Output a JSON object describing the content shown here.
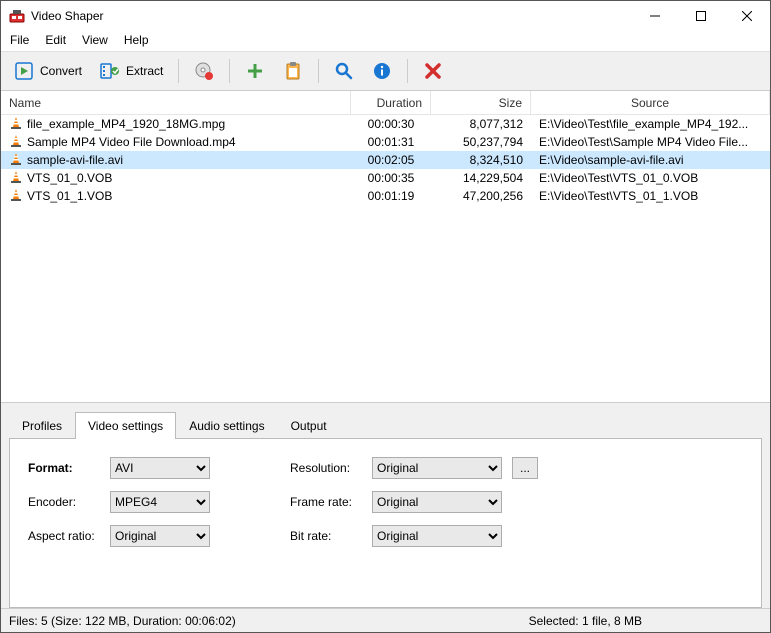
{
  "window": {
    "title": "Video Shaper"
  },
  "menubar": [
    "File",
    "Edit",
    "View",
    "Help"
  ],
  "toolbar": {
    "convert_label": "Convert",
    "extract_label": "Extract"
  },
  "columns": {
    "name": "Name",
    "duration": "Duration",
    "size": "Size",
    "source": "Source"
  },
  "files": [
    {
      "name": "file_example_MP4_1920_18MG.mpg",
      "duration": "00:00:30",
      "size": "8,077,312",
      "source": "E:\\Video\\Test\\file_example_MP4_192...",
      "selected": false
    },
    {
      "name": "Sample MP4 Video File Download.mp4",
      "duration": "00:01:31",
      "size": "50,237,794",
      "source": "E:\\Video\\Test\\Sample MP4 Video File...",
      "selected": false
    },
    {
      "name": "sample-avi-file.avi",
      "duration": "00:02:05",
      "size": "8,324,510",
      "source": "E:\\Video\\sample-avi-file.avi",
      "selected": true
    },
    {
      "name": "VTS_01_0.VOB",
      "duration": "00:00:35",
      "size": "14,229,504",
      "source": "E:\\Video\\Test\\VTS_01_0.VOB",
      "selected": false
    },
    {
      "name": "VTS_01_1.VOB",
      "duration": "00:01:19",
      "size": "47,200,256",
      "source": "E:\\Video\\Test\\VTS_01_1.VOB",
      "selected": false
    }
  ],
  "tabs": [
    "Profiles",
    "Video settings",
    "Audio settings",
    "Output"
  ],
  "active_tab": 1,
  "video_settings": {
    "labels": {
      "format": "Format:",
      "encoder": "Encoder:",
      "aspect": "Aspect ratio:",
      "resolution": "Resolution:",
      "framerate": "Frame rate:",
      "bitrate": "Bit rate:"
    },
    "values": {
      "format": "AVI",
      "encoder": "MPEG4",
      "aspect": "Original",
      "resolution": "Original",
      "framerate": "Original",
      "bitrate": "Original"
    },
    "dots": "..."
  },
  "status": {
    "left": "Files: 5 (Size: 122 MB, Duration: 00:06:02)",
    "right": "Selected: 1 file, 8 MB"
  }
}
